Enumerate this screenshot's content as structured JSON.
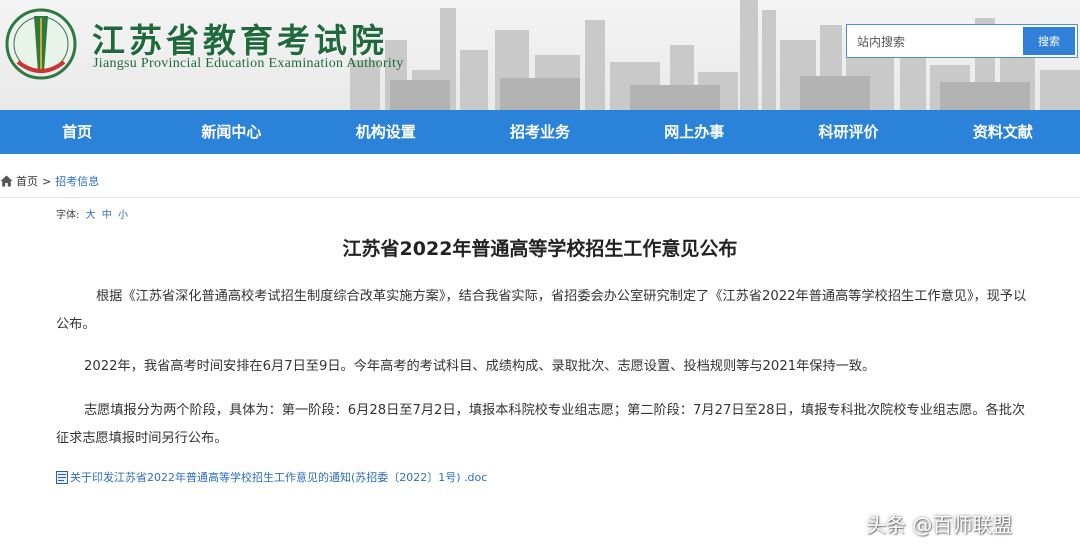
{
  "header": {
    "title": "江苏省教育考试院",
    "subtitle": "Jiangsu Provincial Education Examination Authority",
    "search": {
      "placeholder": "站内搜索",
      "button_label": "搜索"
    }
  },
  "nav": {
    "items": [
      "首页",
      "新闻中心",
      "机构设置",
      "招考业务",
      "网上办事",
      "科研评价",
      "资料文献"
    ]
  },
  "breadcrumb": {
    "home": "首页",
    "separator": ">",
    "current": "招考信息"
  },
  "article": {
    "font_size_label": "字体:",
    "font_size_options": [
      "大",
      "中",
      "小"
    ],
    "title": "江苏省2022年普通高等学校招生工作意见公布",
    "paragraphs": [
      "根据《江苏省深化普通高校考试招生制度综合改革实施方案》，结合我省实际，省招委会办公室研究制定了《江苏省2022年普通高等学校招生工作意见》，现予以公布。",
      "2022年，我省高考时间安排在6月7日至9日。今年高考的考试科目、成绩构成、录取批次、志愿设置、投档规则等与2021年保持一致。",
      "志愿填报分为两个阶段，具体为：第一阶段：6月28日至7月2日，填报本科院校专业组志愿；第二阶段：7月27日至28日，填报专科批次院校专业组志愿。各批次征求志愿填报时间另行公布。"
    ],
    "attachment": "关于印发江苏省2022年普通高等学校招生工作意见的通知(苏招委〔2022〕1号) .doc"
  },
  "watermark": "头条 @百师联盟",
  "colors": {
    "nav_bg": "#2b83d9",
    "title_green": "#1f6a3a",
    "link_blue": "#2b6fc2"
  }
}
